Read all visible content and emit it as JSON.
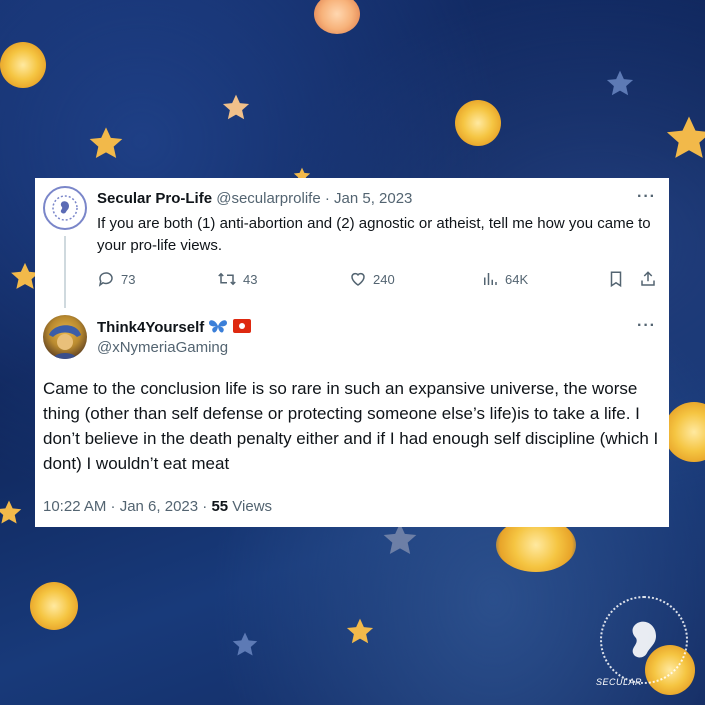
{
  "tweet1": {
    "name": "Secular Pro-Life",
    "handle": "@secularprolife",
    "separator": " · ",
    "date": "Jan 5, 2023",
    "text": "If you are both (1) anti-abortion and (2) agnostic or atheist, tell me how you came to your pro-life views.",
    "more": "···",
    "stats": {
      "replies": "73",
      "retweets": "43",
      "likes": "240",
      "views": "64K"
    }
  },
  "tweet2": {
    "name": "Think4Yourself",
    "handle": "@xNymeriaGaming",
    "more": "···",
    "text": "Came to the conclusion life is so rare in such an expansive universe, the worse thing (other than self defense or protecting someone else’s life)is to take a life. I don’t believe in the death penalty either and if I had enough self discipline (which I dont) I wouldn’t eat meat",
    "time": "10:22 AM · Jan 6, 2023 · ",
    "view_count": "55",
    "views_label": " Views",
    "badges": [
      "butterfly-icon",
      "hong-kong-flag-icon"
    ]
  },
  "watermark": {
    "text": "SECULAR"
  },
  "colors": {
    "background": "#12285e",
    "card": "#ffffff",
    "text_primary": "#0f1419",
    "text_secondary": "#536471",
    "star": "#f2b94a"
  }
}
